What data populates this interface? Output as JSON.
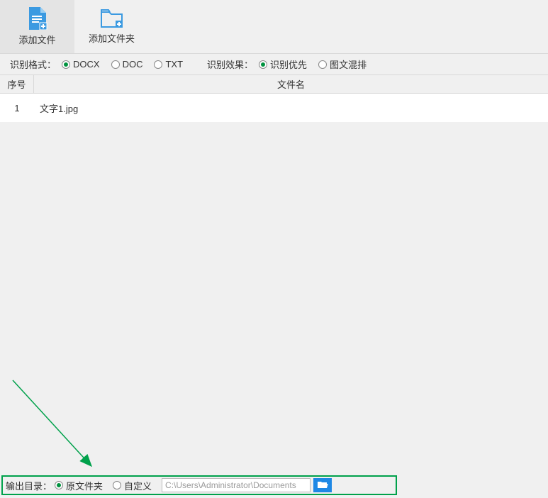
{
  "toolbar": {
    "add_file": "添加文件",
    "add_folder": "添加文件夹"
  },
  "options": {
    "format_label": "识别格式：",
    "docx": "DOCX",
    "doc": "DOC",
    "txt": "TXT",
    "effect_label": "识别效果：",
    "priority": "识别优先",
    "mixed": "图文混排"
  },
  "table": {
    "seq_header": "序号",
    "name_header": "文件名",
    "rows": [
      {
        "seq": "1",
        "name": "文字1.jpg"
      }
    ]
  },
  "output": {
    "label": "输出目录：",
    "orig": "原文件夹",
    "custom": "自定义",
    "path": "C:\\Users\\Administrator\\Documents"
  }
}
